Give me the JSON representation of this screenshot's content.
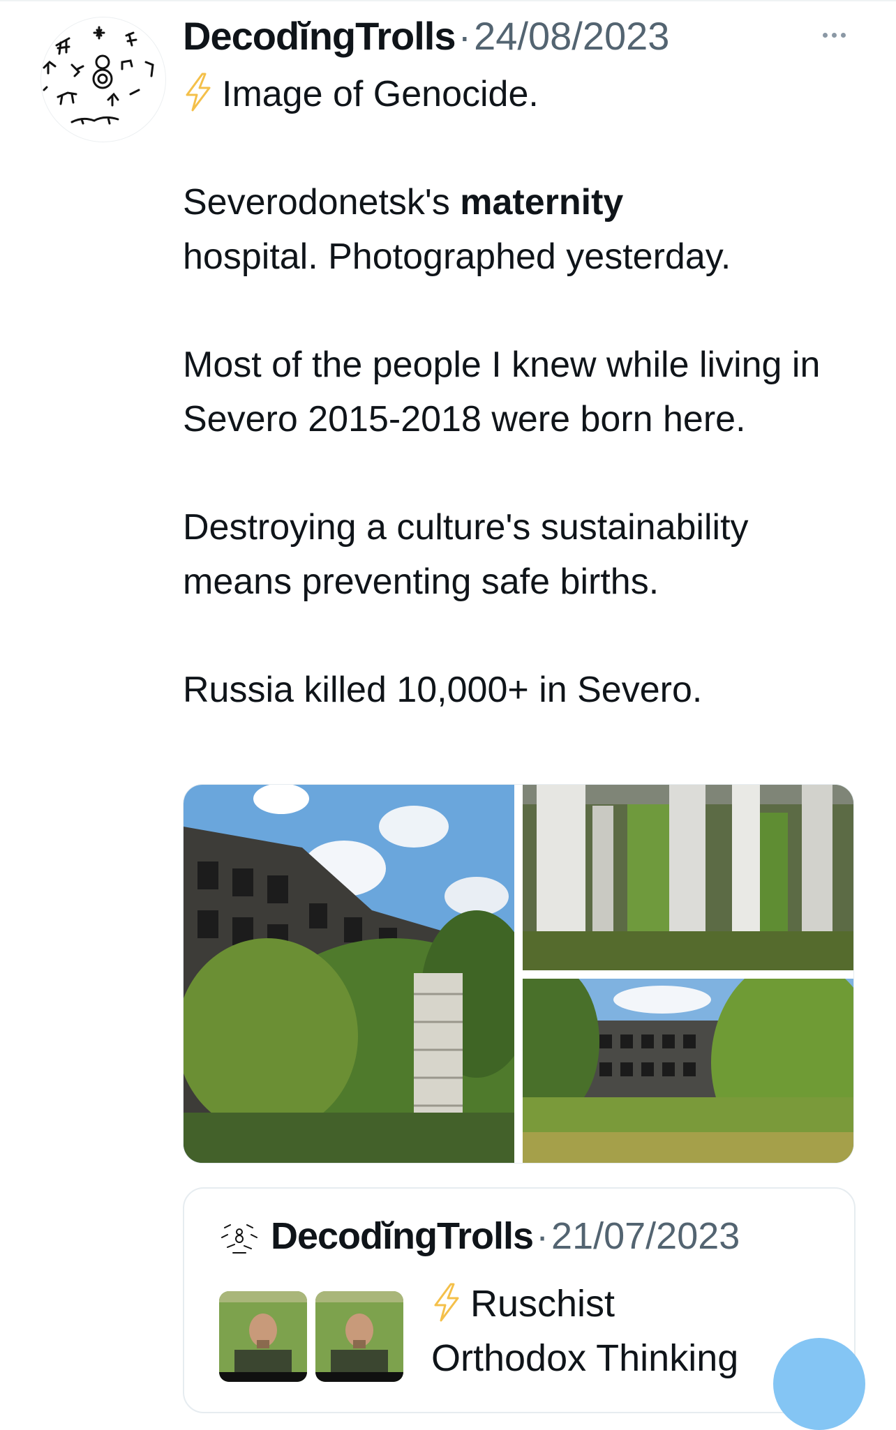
{
  "tweet": {
    "author": "DecodĭngTrolls",
    "separator": "·",
    "date": "24/08/2023",
    "line1": "Image of Genocide.",
    "p2_before": "Severodonetsk's ",
    "p2_bold": "maternity",
    "p2_after": "hospital. Photographed yesterday.",
    "p3": "Most of the people I knew while living in Severo 2015-2018 were born here.",
    "p4": "Destroying a culture's sustainability means preventing safe births.",
    "p5": "Russia killed 10,000+ in Severo."
  },
  "quoted": {
    "author": "DecodĭngTrolls",
    "separator": "·",
    "date": "21/07/2023",
    "line1": "Ruschist",
    "line2": "Orthodox Thinking"
  },
  "icons": {
    "bolt": "lightning-bolt-icon",
    "more": "more-options-icon"
  },
  "colors": {
    "text": "#0f1419",
    "secondary": "#536471",
    "bolt": "#f4c04a",
    "fab": "#84c5f4"
  }
}
